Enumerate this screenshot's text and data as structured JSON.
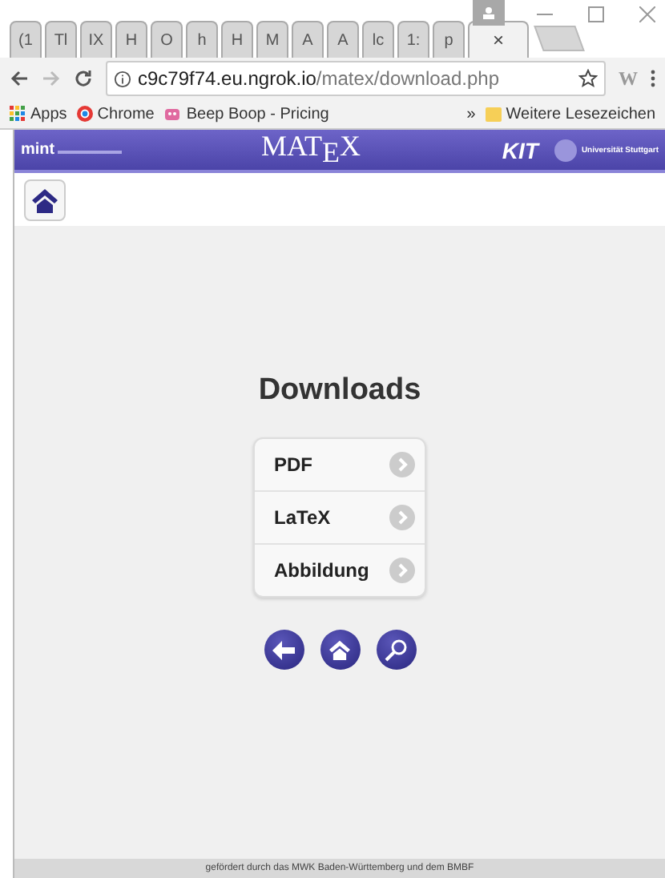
{
  "browser": {
    "tabs": [
      {
        "label": "(1",
        "selected": false
      },
      {
        "label": "Tl",
        "selected": false
      },
      {
        "label": "IX",
        "selected": false
      },
      {
        "label": "H",
        "selected": false
      },
      {
        "label": "O",
        "selected": false
      },
      {
        "label": "h",
        "selected": false
      },
      {
        "label": "H",
        "selected": false
      },
      {
        "label": "M",
        "selected": false
      },
      {
        "label": "A",
        "selected": false
      },
      {
        "label": "A",
        "selected": false
      },
      {
        "label": "lc",
        "selected": false
      },
      {
        "label": "1:",
        "selected": false
      },
      {
        "label": "p",
        "selected": false
      },
      {
        "label": "×",
        "selected": true
      }
    ],
    "url_host": "c9c79f74.eu.ngrok.io",
    "url_path": "/matex/download.php",
    "extension": "W",
    "bookmarks": [
      "Apps",
      "Chrome",
      "Beep Boop - Pricing"
    ],
    "overflow": "»",
    "other_bookmarks": "Weitere Lesezeichen"
  },
  "header": {
    "left_logo": "mint",
    "title": "MAT$_{E}$X",
    "kit_logo": "KIT",
    "right_logo": "Universität Stuttgart"
  },
  "heading": "Downloads",
  "downloads": [
    {
      "label": "PDF"
    },
    {
      "label": "LaTeX"
    },
    {
      "label": "Abbildung"
    }
  ],
  "footer": "gefördert durch das MWK Baden-Württemberg und dem BMBF"
}
